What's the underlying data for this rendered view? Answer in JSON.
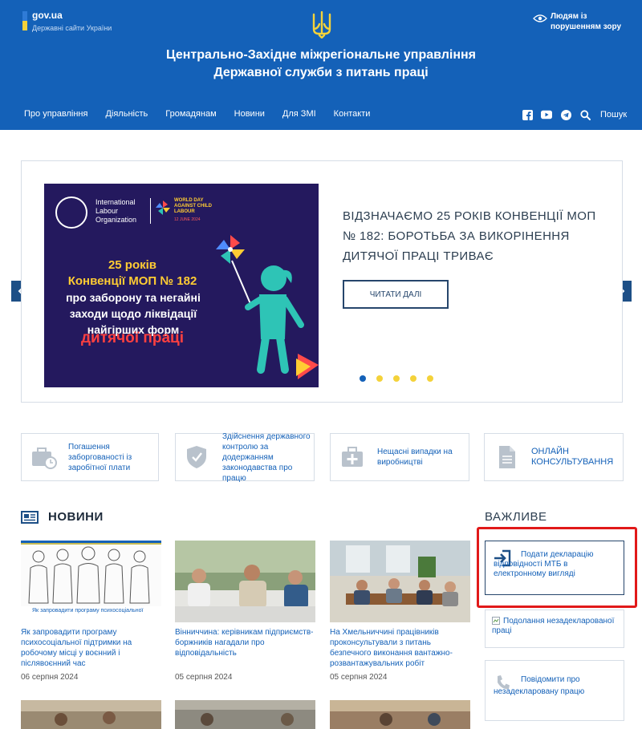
{
  "header": {
    "gov_name": "gov.ua",
    "gov_sub": "Державні сайти України",
    "accessibility": "Людям із порушенням зору",
    "title_line1": "Центрально-Західне міжрегіональне управління",
    "title_line2": "Державної служби з питань праці",
    "nav": [
      "Про управління",
      "Діяльність",
      "Громадянам",
      "Новини",
      "Для ЗМІ",
      "Контакти"
    ],
    "search_label": "Пошук",
    "colors": {
      "header_bg": "#1461b8",
      "accent_yellow": "#f4d23a"
    }
  },
  "slider": {
    "banner": {
      "org_name": "International Labour Organization",
      "world_day": "WORLD DAY AGAINST CHILD LABOUR",
      "world_day_date": "12 JUNE 2024",
      "line1": "25 років",
      "line2": "Конвенції МОП № 182",
      "line3": "про заборону та негайні заходи щодо ліквідації найгірших форм",
      "line4": "дитячої праці"
    },
    "title": "ВІДЗНАЧАЄМО 25 РОКІВ КОНВЕНЦІЇ МОП № 182: БОРОТЬБА ЗА ВИКОРІНЕННЯ ДИТЯЧОЇ ПРАЦІ ТРИВАЄ",
    "read_more": "ЧИТАТИ ДАЛІ",
    "slide_count": 5,
    "active_slide": 1
  },
  "services": [
    {
      "label": "Погашення заборгованості із заробітної плати",
      "icon": "briefcase-clock-icon"
    },
    {
      "label": "Здійснення державного контролю за додержанням законодавства про працю",
      "icon": "shield-check-icon"
    },
    {
      "label": "Нещасні випадки на виробництві",
      "icon": "first-aid-kit-icon"
    },
    {
      "label": "ОНЛАЙН КОНСУЛЬТУВАННЯ",
      "icon": "document-icon"
    }
  ],
  "news": {
    "heading": "НОВИНИ",
    "items": [
      {
        "title": "Як запровадити програму психосоціальної підтримки на робочому місці у воєнний і післявоєнний час",
        "date": "06 серпня 2024",
        "caption": "Як запровадити програму психосоціальної"
      },
      {
        "title": "Вінниччина: керівникам підприємств-боржників нагадали про відповідальність",
        "date": "05 серпня 2024"
      },
      {
        "title": "На Хмельниччині працівників проконсультували з питань безпечного виконання вантажно-розвантажувальних робіт",
        "date": "05 серпня 2024"
      }
    ]
  },
  "important": {
    "heading": "ВАЖЛИВЕ",
    "items": [
      {
        "label": "Подати декларацію відповідності МТБ в електронному вигляді",
        "icon": "sign-in-icon"
      },
      {
        "label": "Подолання незадекларованої праці",
        "icon": "broken-image-icon"
      },
      {
        "label": "Повідомити про незадекларовану працю",
        "icon": "phone-icon"
      }
    ]
  }
}
